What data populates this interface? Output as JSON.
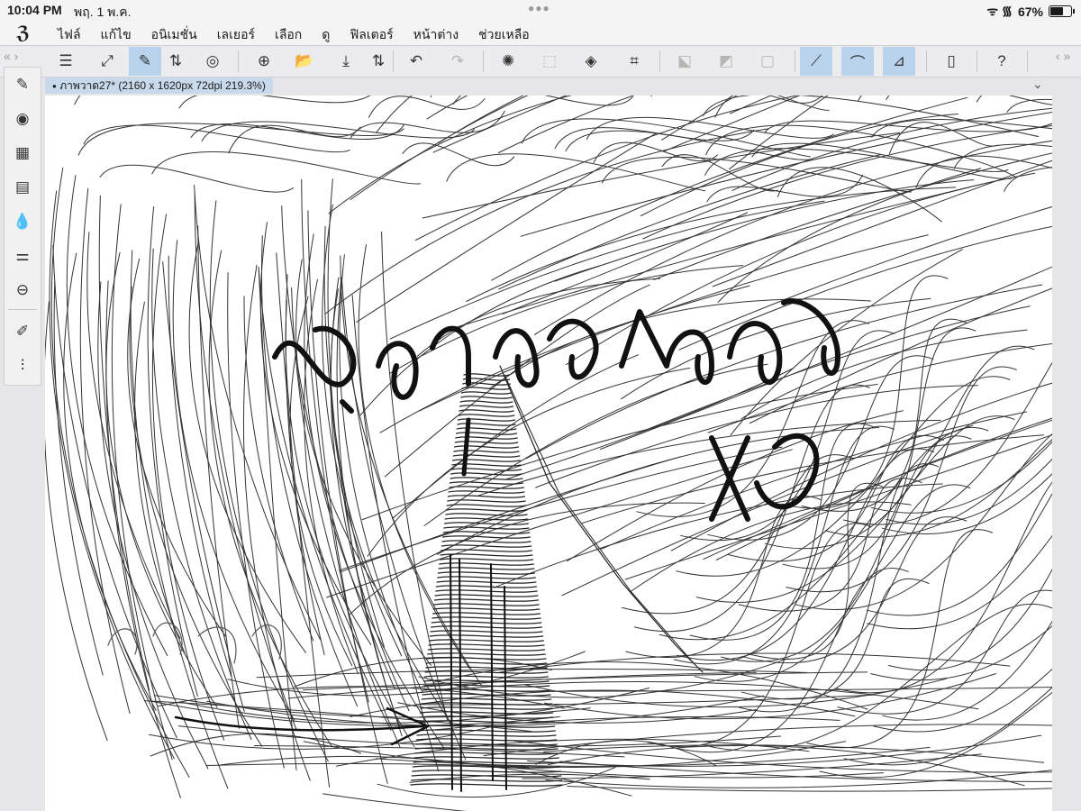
{
  "status": {
    "time": "10:04 PM",
    "date": "พฤ. 1 พ.ค.",
    "signal": "ᯤ ᯾",
    "battery_pct": "67%"
  },
  "menu": {
    "logo": "ℨ",
    "items": [
      "ไฟล์",
      "แก้ไข",
      "อนิเมชั่น",
      "เลเยอร์",
      "เลือก",
      "ดู",
      "ฟิลเตอร์",
      "หน้าต่าง",
      "ช่วยเหลือ"
    ]
  },
  "toolbar": {
    "collapse_left": "« ›",
    "collapse_right": "‹ »",
    "icons": [
      {
        "name": "menu-icon",
        "glyph": "☰"
      },
      {
        "name": "fullscreen-icon",
        "glyph": "⤢"
      },
      {
        "name": "quick-access-icon",
        "glyph": "✎"
      },
      {
        "name": "updown-icon",
        "glyph": "⇅"
      },
      {
        "name": "companion-icon",
        "glyph": "◎"
      },
      {
        "name": "new-canvas-icon",
        "glyph": "⊕"
      },
      {
        "name": "open-folder-icon",
        "glyph": "📂"
      },
      {
        "name": "save-icon",
        "glyph": "⤓"
      },
      {
        "name": "save-updown-icon",
        "glyph": "⇅"
      },
      {
        "name": "undo-icon",
        "glyph": "↶"
      },
      {
        "name": "redo-icon",
        "glyph": "↷"
      },
      {
        "name": "loading-icon",
        "glyph": "✺"
      },
      {
        "name": "deselect-icon",
        "glyph": "⬚"
      },
      {
        "name": "fill-icon",
        "glyph": "◈"
      },
      {
        "name": "transform-icon",
        "glyph": "⌗"
      },
      {
        "name": "clear-selection-icon",
        "glyph": "⬕"
      },
      {
        "name": "gradient-icon",
        "glyph": "◩"
      },
      {
        "name": "crop-icon",
        "glyph": "▢"
      },
      {
        "name": "ruler-pen-icon",
        "glyph": "⟋"
      },
      {
        "name": "brush-snap-icon",
        "glyph": "⌒"
      },
      {
        "name": "ruler-snap-icon",
        "glyph": "⊿"
      },
      {
        "name": "device-icon",
        "glyph": "▯"
      },
      {
        "name": "help-icon",
        "glyph": "?"
      }
    ]
  },
  "left_tools": [
    {
      "name": "pen-tool-icon",
      "glyph": "✎"
    },
    {
      "name": "subtool-icon",
      "glyph": "◉"
    },
    {
      "name": "color-palette-icon",
      "glyph": "▦"
    },
    {
      "name": "timeline-icon",
      "glyph": "▤"
    },
    {
      "name": "color-mix-icon",
      "glyph": "💧"
    },
    {
      "name": "tool-property-icon",
      "glyph": "⚌"
    },
    {
      "name": "navigator-icon",
      "glyph": "⊖"
    },
    {
      "name": "pencil-icon",
      "glyph": "✐"
    },
    {
      "name": "adjust-icon",
      "glyph": "⫶"
    }
  ],
  "canvas": {
    "tab_title": "ภาพวาด27* (2160 x 1620px 72dpi 219.3%)",
    "tab_dot": "●",
    "chevron": "⌄"
  }
}
